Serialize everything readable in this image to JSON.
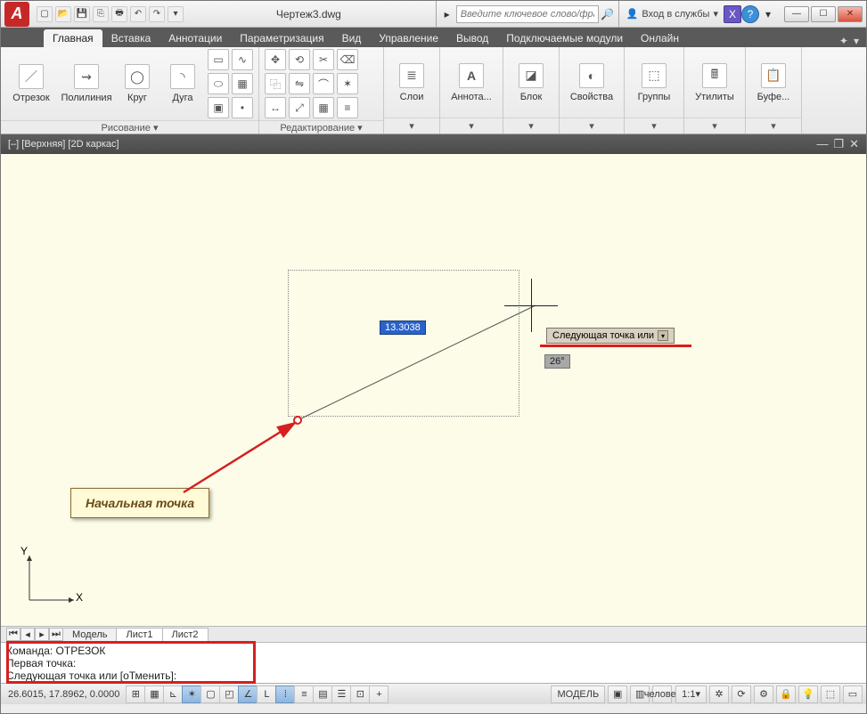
{
  "app_icon_letter": "A",
  "title": "Чертеж3.dwg",
  "search_placeholder": "Введите ключевое слово/фразу",
  "login_text": "Вход в службы",
  "tabs": [
    "Главная",
    "Вставка",
    "Аннотации",
    "Параметризация",
    "Вид",
    "Управление",
    "Вывод",
    "Подключаемые модули",
    "Онлайн"
  ],
  "ribbon": {
    "draw_panel": "Рисование ▾",
    "edit_panel": "Редактирование ▾",
    "draw_big": [
      "Отрезок",
      "Полилиния",
      "Круг",
      "Дуга"
    ],
    "groups": {
      "layers": "Слои",
      "annot": "Аннота...",
      "block": "Блок",
      "props": "Свойства",
      "grps": "Группы",
      "utils": "Утилиты",
      "clip": "Буфе..."
    }
  },
  "viewport_label": "[–] [Верхняя] [2D каркас]",
  "drawing": {
    "dim_value": "13.3038",
    "tooltip": "Следующая точка или",
    "angle": "26°",
    "callout": "Начальная точка"
  },
  "layout_tabs": [
    "Модель",
    "Лист1",
    "Лист2"
  ],
  "command": {
    "hist1": "Команда: ОТРЕЗОК",
    "hist2": "Первая точка:",
    "prompt": "Следующая точка или [оТменить]:"
  },
  "status": {
    "coords": "26.6015, 17.8962, 0.0000",
    "model": "МОДЕЛЬ",
    "scale": "1:1"
  },
  "ucs": {
    "x": "X",
    "y": "Y"
  }
}
